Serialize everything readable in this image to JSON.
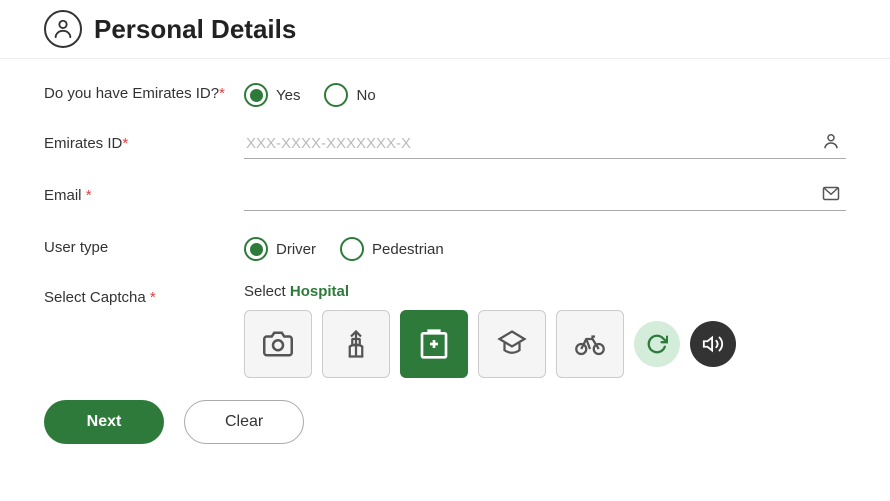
{
  "header": {
    "title": "Personal Details",
    "icon_label": "person-icon"
  },
  "form": {
    "emirates_id_question": {
      "label": "Do you have Emirates ID?",
      "required": true,
      "options": [
        {
          "label": "Yes",
          "selected": true
        },
        {
          "label": "No",
          "selected": false
        }
      ]
    },
    "emirates_id_field": {
      "label": "Emirates ID",
      "required": true,
      "placeholder": "XXX-XXXX-XXXXXXX-X",
      "value": ""
    },
    "email_field": {
      "label": "Email",
      "required": true,
      "placeholder": "",
      "value": ""
    },
    "user_type": {
      "label": "User type",
      "required": false,
      "options": [
        {
          "label": "Driver",
          "selected": true
        },
        {
          "label": "Pedestrian",
          "selected": false
        }
      ]
    },
    "captcha": {
      "label": "Select Captcha",
      "required": true,
      "prompt": "Select",
      "target_word": "Hospital",
      "icons": [
        {
          "name": "camera-icon",
          "symbol": "📷",
          "selected": false,
          "unicode": "camera"
        },
        {
          "name": "building-icon",
          "symbol": "🗼",
          "selected": false,
          "unicode": "building"
        },
        {
          "name": "hospital-icon",
          "symbol": "🏥",
          "selected": true,
          "unicode": "H"
        },
        {
          "name": "graduation-icon",
          "symbol": "🎓",
          "selected": false,
          "unicode": "graduation"
        },
        {
          "name": "bicycle-icon",
          "symbol": "🚲",
          "selected": false,
          "unicode": "bicycle"
        }
      ],
      "refresh_label": "refresh",
      "sound_label": "sound"
    }
  },
  "buttons": {
    "next_label": "Next",
    "clear_label": "Clear"
  }
}
